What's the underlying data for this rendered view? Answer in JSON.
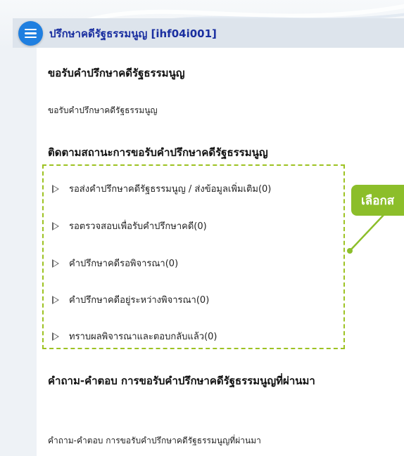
{
  "header": {
    "title": "ปรึกษาคดีรัฐธรรมนูญ [ihf04i001]"
  },
  "colors": {
    "accent_blue": "#1f7fe0",
    "title_blue": "#1a2fa0",
    "callout_green": "#8cbe2a",
    "dashed_border": "#9dc222"
  },
  "sections": {
    "request": {
      "heading": "ขอรับคำปรึกษาคดีรัฐธรรมนูญ",
      "link": "ขอรับคำปรึกษาคดีรัฐธรรมนูญ"
    },
    "tracking": {
      "heading": "ติดตามสถานะการขอรับคำปรึกษาคดีรัฐธรรมนูญ",
      "items": [
        {
          "label": "รอส่งคำปรึกษาคดีรัฐธรรมนูญ / ส่งข้อมูลเพิ่มเติม(0)",
          "icon": "play-triangle-icon"
        },
        {
          "label": "รอตรวจสอบเพื่อรับคำปรึกษาคดี(0)",
          "icon": "play-triangle-icon"
        },
        {
          "label": "คำปรึกษาคดีรอพิจารณา(0)",
          "icon": "play-triangle-icon"
        },
        {
          "label": "คำปรึกษาคดีอยู่ระหว่างพิจารณา(0)",
          "icon": "play-triangle-icon"
        },
        {
          "label": "ทราบผลพิจารณาและตอบกลับแล้ว(0)",
          "icon": "play-triangle-icon"
        }
      ]
    },
    "qa": {
      "heading": "คำถาม-คำตอบ การขอรับคำปรึกษาคดีรัฐธรรมนูญที่ผ่านมา",
      "link": "คำถาม-คำตอบ การขอรับคำปรึกษาคดีรัฐธรรมนูญที่ผ่านมา"
    }
  },
  "callout": {
    "text": "เลือกส"
  }
}
